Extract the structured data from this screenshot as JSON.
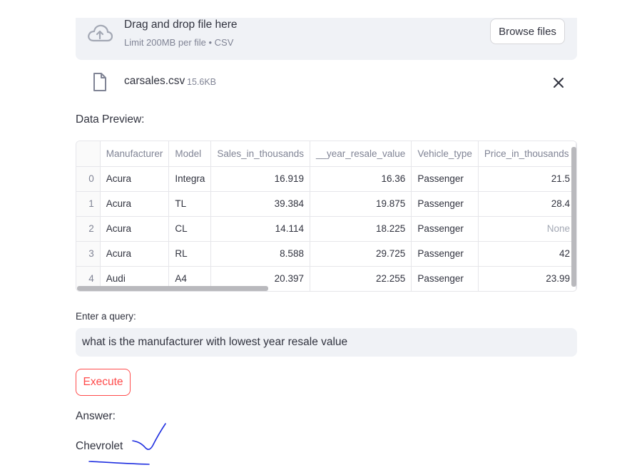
{
  "uploader": {
    "title": "Drag and drop file here",
    "subtitle": "Limit 200MB per file • CSV",
    "browse_label": "Browse files",
    "icon": "cloud-upload-icon"
  },
  "file": {
    "name": "carsales.csv",
    "size": "15.6KB",
    "icon": "file-icon",
    "remove_icon": "close-icon"
  },
  "preview": {
    "label": "Data Preview:",
    "columns": [
      "",
      "Manufacturer",
      "Model",
      "Sales_in_thousands",
      "__year_resale_value",
      "Vehicle_type",
      "Price_in_thousands"
    ],
    "rows": [
      [
        "0",
        "Acura",
        "Integra",
        "16.919",
        "16.36",
        "Passenger",
        "21.5"
      ],
      [
        "1",
        "Acura",
        "TL",
        "39.384",
        "19.875",
        "Passenger",
        "28.4"
      ],
      [
        "2",
        "Acura",
        "CL",
        "14.114",
        "18.225",
        "Passenger",
        "None"
      ],
      [
        "3",
        "Acura",
        "RL",
        "8.588",
        "29.725",
        "Passenger",
        "42"
      ],
      [
        "4",
        "Audi",
        "A4",
        "20.397",
        "22.255",
        "Passenger",
        "23.99"
      ]
    ]
  },
  "query": {
    "label": "Enter a query:",
    "value": "what is the manufacturer with lowest year resale value"
  },
  "execute_label": "Execute",
  "answer": {
    "label": "Answer:",
    "value": "Chevrolet"
  },
  "colors": {
    "accent": "#ff4b4b",
    "annotation_ink": "#1f2fe0",
    "panel_bg": "#f0f2f6"
  }
}
